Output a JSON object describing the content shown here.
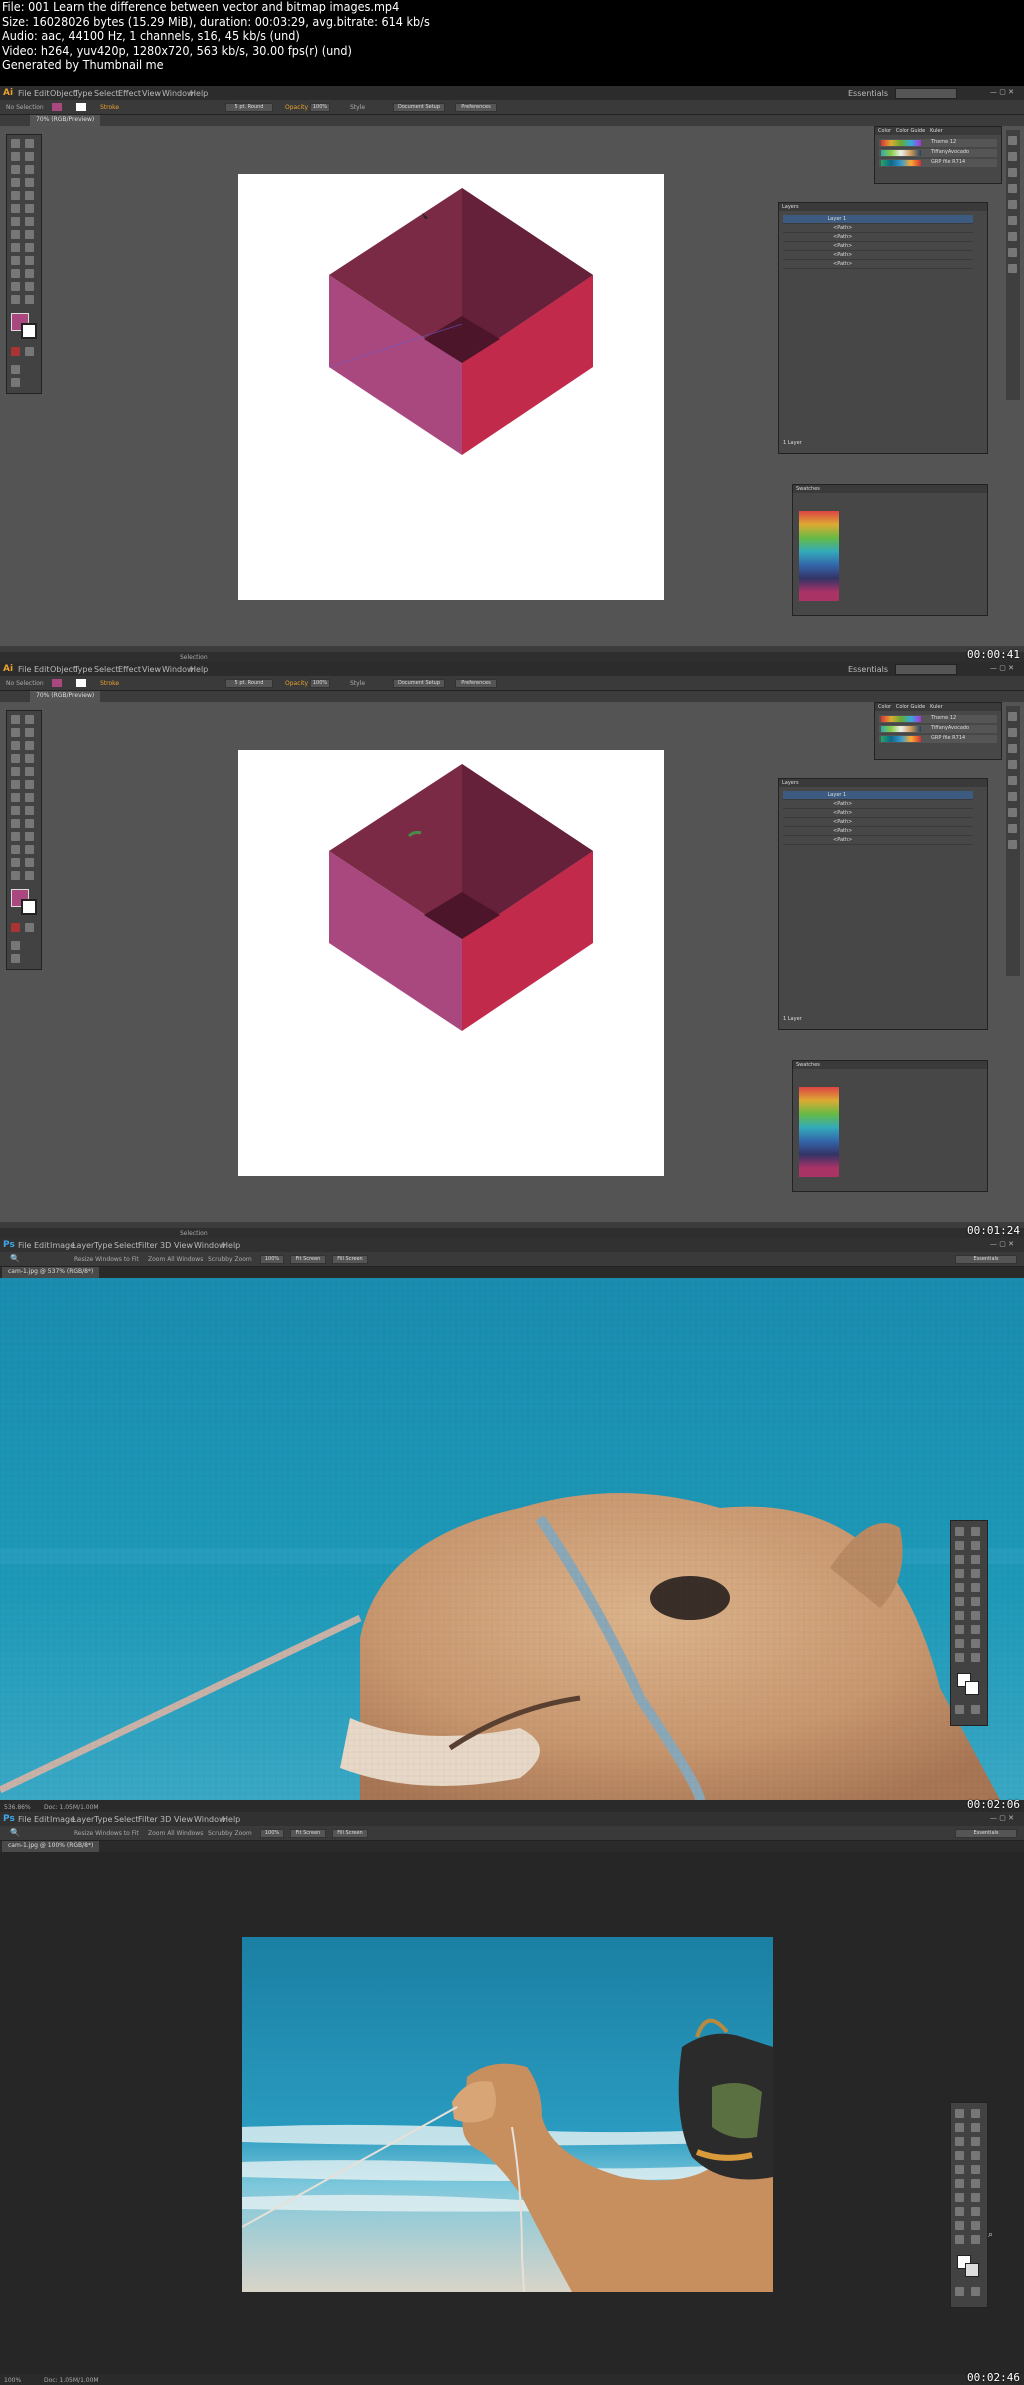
{
  "info_lines": [
    "File: 001 Learn the difference between vector and bitmap images.mp4",
    "Size: 16028026 bytes (15.29 MiB), duration: 00:03:29, avg.bitrate: 614 kb/s",
    "Audio: aac, 44100 Hz, 1 channels, s16, 45 kb/s (und)",
    "Video: h264, yuv420p, 1280x720, 563 kb/s, 30.00 fps(r) (und)",
    "Generated by Thumbnail me"
  ],
  "frames": [
    {
      "app": "Ai",
      "timestamp": "00:00:41"
    },
    {
      "app": "Ai",
      "timestamp": "00:01:24"
    },
    {
      "app": "Ps",
      "timestamp": "00:02:06"
    },
    {
      "app": "Ps",
      "timestamp": "00:02:46"
    }
  ],
  "illustrator": {
    "menus": [
      "File",
      "Edit",
      "Object",
      "Type",
      "Select",
      "Effect",
      "View",
      "Window",
      "Help"
    ],
    "workspace": "Essentials",
    "selection_label": "No Selection",
    "stroke_label": "Stroke",
    "brush": "5 pt. Round",
    "opacity_label": "Opacity",
    "opacity": "100%",
    "style_label": "Style",
    "doc_setup": "Document Setup",
    "preferences": "Preferences",
    "doc_tab": "70% (RGB/Preview)",
    "status_mode": "Selection",
    "colors": {
      "top": "#7a2a45",
      "front": "#a8487f",
      "right": "#c22a4b",
      "inner": "#5e1c33",
      "fill_swatch": "#a8487f",
      "artboard": "#ffffff"
    },
    "panels": {
      "guide_tabs": [
        "Color",
        "Color Guide",
        "Kuler"
      ],
      "themes": [
        "Theme 12",
        "TiffanyAvocado",
        "GRP file R714"
      ],
      "layers_title": "Layers",
      "layer_name": "Layer 1",
      "sublayers": [
        "<Path>",
        "<Path>",
        "<Path>",
        "<Path>",
        "<Path>"
      ],
      "layers_footer": "1 Layer",
      "swatches_title": "Swatches"
    }
  },
  "photoshop": {
    "menus": [
      "File",
      "Edit",
      "Image",
      "Layer",
      "Type",
      "Select",
      "Filter",
      "3D",
      "View",
      "Window",
      "Help"
    ],
    "options": [
      "Resize Windows to Fit",
      "Zoom All Windows",
      "Scrubby Zoom",
      "100%",
      "Fit Screen",
      "Fill Screen"
    ],
    "workspace": "Essentials",
    "doc_tab_zoomed": "cam-1.jpg @ 537% (RGB/8*)",
    "doc_tab_normal": "cam-1.jpg @ 100% (RGB/8*)",
    "status_zoomed": "536.86%",
    "status_normal": "100%",
    "doc_info": "Doc: 1.05M/1.00M",
    "colors": {
      "sky": "#1c8fb0",
      "camel": "#c99870"
    }
  }
}
